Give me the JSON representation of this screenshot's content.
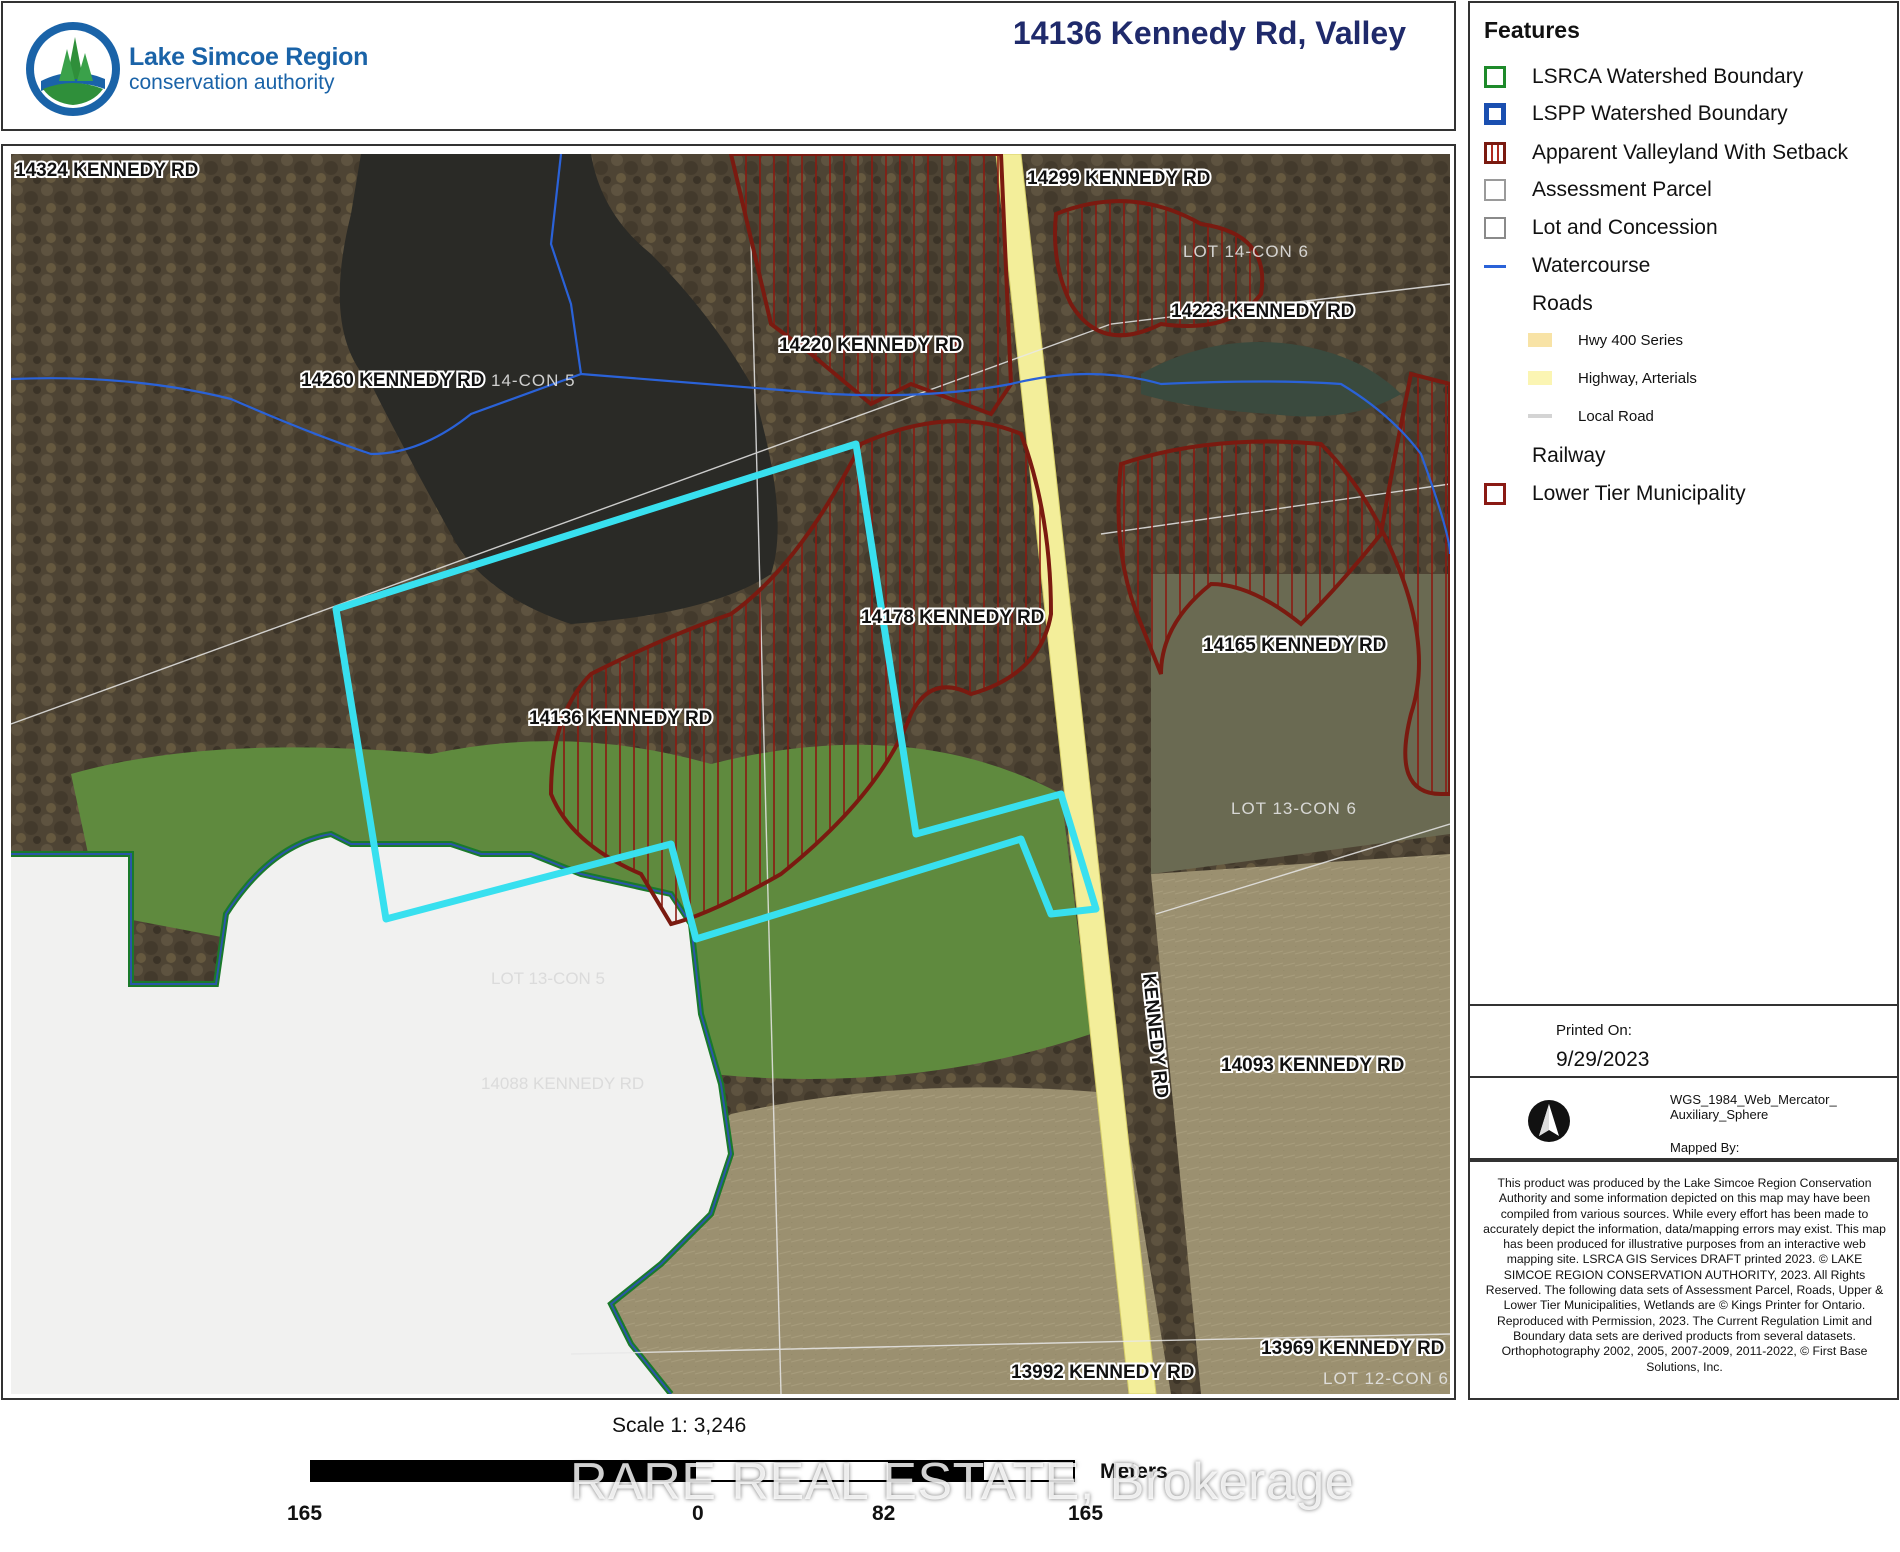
{
  "header": {
    "org_name": "Lake Simcoe Region",
    "org_sub": "conservation authority",
    "title": "14136 Kennedy Rd, Valley"
  },
  "features": {
    "title": "Features",
    "items": [
      {
        "label": "LSRCA Watershed Boundary",
        "icon": "green-outline-square"
      },
      {
        "label": "LSPP Watershed Boundary",
        "icon": "blue-outline-square"
      },
      {
        "label": "Apparent Valleyland With Setback",
        "icon": "red-hatched-square"
      },
      {
        "label": "Assessment Parcel",
        "icon": "grey-outline-square"
      },
      {
        "label": "Lot and Concession",
        "icon": "grey-outline-square"
      },
      {
        "label": "Watercourse",
        "icon": "blue-line"
      },
      {
        "label": "Roads",
        "icon": ""
      }
    ],
    "roads": [
      {
        "label": "Hwy 400 Series",
        "color": "#f8e3a6"
      },
      {
        "label": "Highway, Arterials",
        "color": "#fbf5b3"
      },
      {
        "label": "Local Road",
        "color": "#d4d4d4"
      }
    ],
    "railway": "Railway",
    "municipality": "Lower Tier Municipality"
  },
  "printed": {
    "label": "Printed On:",
    "date": "9/29/2023"
  },
  "projection": "WGS_1984_Web_Mercator_ Auxiliary_Sphere",
  "mapped_by": "Mapped By:",
  "disclaimer": "This product was produced by the Lake Simcoe Region Conservation Authority and some information depicted on this map may have been compiled from various sources. While every effort has been made to accurately depict the information, data/mapping errors may exist.  This map has been produced for illustrative purposes from an interactive web mapping site. LSRCA GIS Services DRAFT printed 2023. © LAKE SIMCOE REGION CONSERVATION AUTHORITY, 2023. All Rights Reserved. The following data sets of Assessment Parcel, Roads, Upper & Lower Tier Municipalities, Wetlands are © Kings Printer for Ontario. Reproduced with Permission, 2023. The Current Regulation Limit and Boundary data sets are derived products from several datasets. Orthophotography 2002, 2005, 2007-2009, 2011-2022,  © First Base Solutions, Inc.",
  "scale": {
    "text": "Scale 1:   3,246",
    "ticks": [
      "165",
      "0",
      "82",
      "165"
    ],
    "units": "Meters"
  },
  "watermark": "RARE REAL ESTATE, Brokerage",
  "map": {
    "address_labels": [
      "14324 KENNEDY RD",
      "14299 KENNEDY RD",
      "14260 KENNEDY RD",
      "14220 KENNEDY RD",
      "14223 KENNEDY RD",
      "14178 KENNEDY RD",
      "14165 KENNEDY RD",
      "14136 KENNEDY RD",
      "14093 KENNEDY RD",
      "13992 KENNEDY RD",
      "13969 KENNEDY RD"
    ],
    "faint_labels": [
      "LOT 13-CON 5",
      "14088 KENNEDY RD"
    ],
    "lot_labels": [
      "LOT 14-CON 6",
      "14-CON 5",
      "LOT 13-CON 6",
      "LOT 12-CON 6"
    ],
    "road_name": "KENNEDY RD",
    "colors": {
      "subject_parcel": "#38e0ef",
      "valleyland": "#7a1a10",
      "watershed": "#1e8a2a",
      "watercourse": "#2a62d8",
      "road": "#f3ee9a"
    }
  }
}
